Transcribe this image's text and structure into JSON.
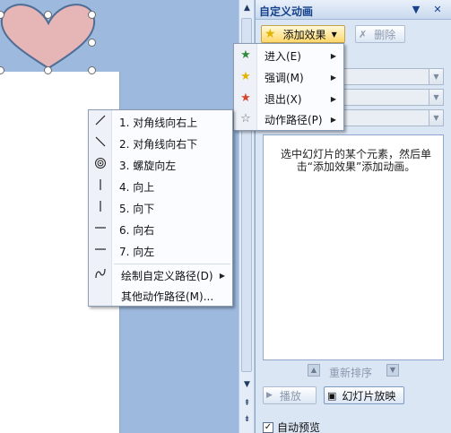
{
  "pane": {
    "title": "自定义动画",
    "add_effect": "添加效果",
    "delete": "删除",
    "hint": "选中幻灯片的某个元素，然后单击“添加效果”添加动画。",
    "reorder": "重新排序",
    "play": "播放",
    "slideshow": "幻灯片放映",
    "autopreview": "自动预览"
  },
  "effect_menu": [
    {
      "label": "进入(E)",
      "icon": "entrance-star-icon",
      "color": "#2e8b3a"
    },
    {
      "label": "强调(M)",
      "icon": "emphasis-star-icon",
      "color": "#e0b400"
    },
    {
      "label": "退出(X)",
      "icon": "exit-star-icon",
      "color": "#d8452b"
    },
    {
      "label": "动作路径(P)",
      "icon": "motion-path-star-icon",
      "color": "#ffffff"
    }
  ],
  "path_menu": [
    {
      "label": "1. 对角线向右上",
      "icon": "diagonal-up-right-icon"
    },
    {
      "label": "2. 对角线向右下",
      "icon": "diagonal-down-right-icon"
    },
    {
      "label": "3. 螺旋向左",
      "icon": "spiral-left-icon"
    },
    {
      "label": "4. 向上",
      "icon": "up-line-icon"
    },
    {
      "label": "5. 向下",
      "icon": "down-line-icon"
    },
    {
      "label": "6. 向右",
      "icon": "right-line-icon"
    },
    {
      "label": "7. 向左",
      "icon": "left-line-icon"
    },
    {
      "label": "绘制自定义路径(D)",
      "icon": "custom-path-icon"
    },
    {
      "label": "其他动作路径(M)...",
      "icon": ""
    }
  ],
  "colors": {
    "heart": "#e6b5b5",
    "heart_stroke": "#4f6d96",
    "hot": "#ffd86b"
  }
}
